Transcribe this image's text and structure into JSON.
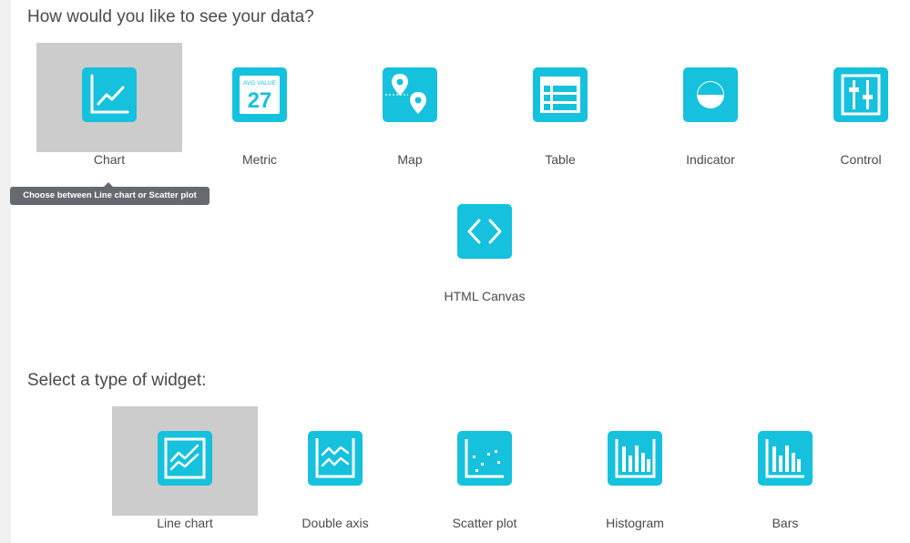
{
  "section_data": {
    "heading": "How would you like to see your data?",
    "options": [
      {
        "label": "Chart",
        "icon": "line-chart-icon",
        "selected": true
      },
      {
        "label": "Metric",
        "icon": "metric-icon",
        "selected": false
      },
      {
        "label": "Map",
        "icon": "map-pin-icon",
        "selected": false
      },
      {
        "label": "Table",
        "icon": "table-icon",
        "selected": false
      },
      {
        "label": "Indicator",
        "icon": "indicator-icon",
        "selected": false
      },
      {
        "label": "Control",
        "icon": "control-sliders-icon",
        "selected": false
      },
      {
        "label": "HTML Canvas",
        "icon": "code-brackets-icon",
        "selected": false
      }
    ],
    "metric_icon_text": {
      "caption": "AVG VALUE",
      "value": "27"
    },
    "tooltip": "Choose between Line chart or Scatter plot"
  },
  "section_widget": {
    "heading": "Select a type of widget:",
    "options": [
      {
        "label": "Line chart",
        "icon": "line-chart-icon",
        "selected": true
      },
      {
        "label": "Double axis",
        "icon": "double-axis-icon",
        "selected": false
      },
      {
        "label": "Scatter plot",
        "icon": "scatter-plot-icon",
        "selected": false
      },
      {
        "label": "Histogram",
        "icon": "histogram-icon",
        "selected": false
      },
      {
        "label": "Bars",
        "icon": "bars-icon",
        "selected": false
      }
    ]
  },
  "colors": {
    "icon_background": "#15c1dc",
    "selected_tile": "#cccccc",
    "tooltip_background": "#666a6e"
  }
}
